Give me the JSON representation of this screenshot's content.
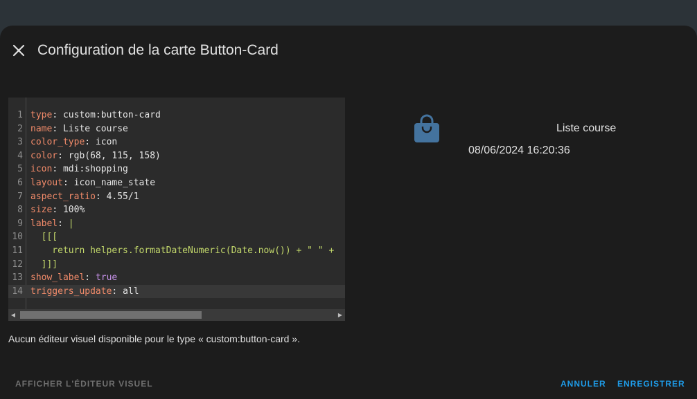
{
  "dialog": {
    "title": "Configuration de la carte Button-Card",
    "close_icon": "close-icon"
  },
  "editor": {
    "lines": [
      {
        "n": "1",
        "key": "type",
        "value": "custom:button-card",
        "vclass": "s"
      },
      {
        "n": "2",
        "key": "name",
        "value": "Liste course",
        "vclass": "s"
      },
      {
        "n": "3",
        "key": "color_type",
        "value": "icon",
        "vclass": "s"
      },
      {
        "n": "4",
        "key": "color",
        "value": "rgb(68, 115, 158)",
        "vclass": "s"
      },
      {
        "n": "5",
        "key": "icon",
        "value": "mdi:shopping",
        "vclass": "s"
      },
      {
        "n": "6",
        "key": "layout",
        "value": "icon_name_state",
        "vclass": "s"
      },
      {
        "n": "7",
        "key": "aspect_ratio",
        "value": "4.55/1",
        "vclass": "s"
      },
      {
        "n": "8",
        "key": "size",
        "value": "100%",
        "vclass": "s"
      },
      {
        "n": "9",
        "key": "label",
        "value": "|",
        "vclass": "p"
      },
      {
        "n": "10",
        "key": "",
        "value": "  [[[",
        "vclass": "p"
      },
      {
        "n": "11",
        "key": "",
        "value": "    return helpers.formatDateNumeric(Date.now()) + \" \" +",
        "vclass": "p"
      },
      {
        "n": "12",
        "key": "",
        "value": "  ]]]",
        "vclass": "p"
      },
      {
        "n": "13",
        "key": "show_label",
        "value": "true",
        "vclass": "b"
      },
      {
        "n": "14",
        "key": "triggers_update",
        "value": "all",
        "vclass": "s"
      }
    ],
    "active_line": 14,
    "scroll_left_icon": "chevron-left-icon",
    "scroll_right_icon": "chevron-right-icon"
  },
  "notice": "Aucun éditeur visuel disponible pour le type « custom:button-card ».",
  "preview": {
    "icon": "shopping-icon",
    "icon_color": "#44739e",
    "name": "Liste course",
    "label": "08/06/2024 16:20:36"
  },
  "actions": {
    "show_visual": "AFFICHER L'ÉDITEUR VISUEL",
    "cancel": "ANNULER",
    "save": "ENREGISTRER"
  },
  "colors": {
    "accent": "#1e9ce9",
    "dialog_bg": "#1c1c1c",
    "editor_bg": "#2b2b2b"
  }
}
